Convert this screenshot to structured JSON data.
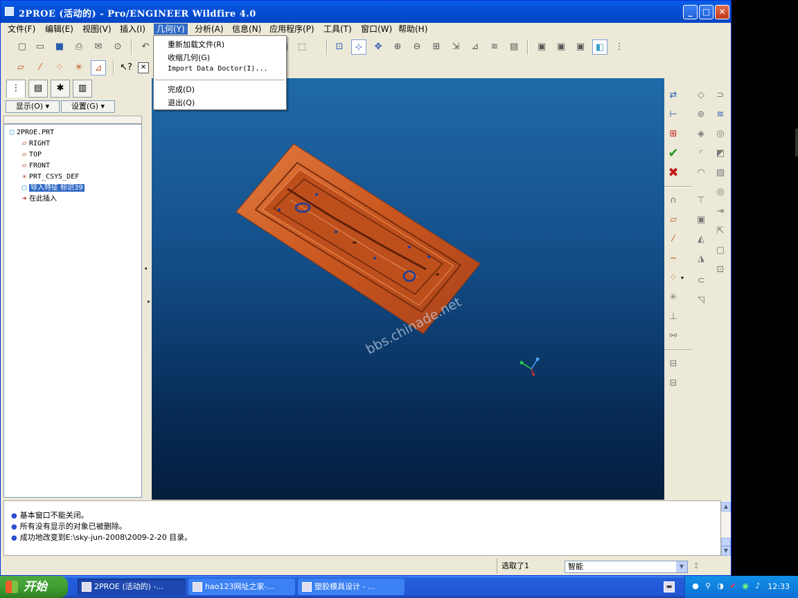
{
  "window": {
    "title": "2PROE (活动的) - Pro/ENGINEER Wildfire 4.0",
    "minimize": "_",
    "maximize": "□",
    "close": "✕"
  },
  "menu": {
    "items": [
      "文件(F)",
      "编辑(E)",
      "视图(V)",
      "插入(I)",
      "几何(Y)",
      "分析(A)",
      "信息(N)",
      "应用程序(P)",
      "工具(T)",
      "窗口(W)",
      "帮助(H)"
    ],
    "active": "几何(Y)"
  },
  "dropdown": {
    "items": [
      "重新加载文件(R)",
      "收缩几何(G)",
      "Import Data Doctor(I)...",
      "完成(D)",
      "退出(Q)"
    ]
  },
  "left_panel": {
    "show_button": "显示(O) ▾",
    "settings_button": "设置(G) ▾",
    "tree": [
      {
        "label": "2PROE.PRT",
        "icon": "part-icon"
      },
      {
        "label": "RIGHT",
        "icon": "datum-plane-icon"
      },
      {
        "label": "TOP",
        "icon": "datum-plane-icon"
      },
      {
        "label": "FRONT",
        "icon": "datum-plane-icon"
      },
      {
        "label": "PRT_CSYS_DEF",
        "icon": "csys-icon"
      },
      {
        "label": "导入特征 标识39",
        "icon": "import-feature-icon",
        "selected": true
      },
      {
        "label": "在此插入",
        "icon": "insert-here-arrow-icon"
      }
    ]
  },
  "viewport": {
    "watermark": "bbs.chinade.net",
    "model_color": "#c9561f"
  },
  "messages": [
    "基本窗口不能关闭。",
    "所有没有显示的对象已被删除。",
    "成功地改变到E:\\sky-jun-2008\\2009-2-20 目录。"
  ],
  "status": {
    "selected": "选取了1",
    "filter": "智能"
  },
  "taskbar": {
    "start": "开始",
    "tasks": [
      "2PROE (活动的) -...",
      "hao123网址之家-...",
      "塑胶模具设计 - ..."
    ],
    "clock": "12:33"
  },
  "colors": {
    "titlebar": "#0550d8",
    "menu_highlight": "#316ac5",
    "viewport_top": "#1f6aa8",
    "viewport_bottom": "#041d3d"
  }
}
